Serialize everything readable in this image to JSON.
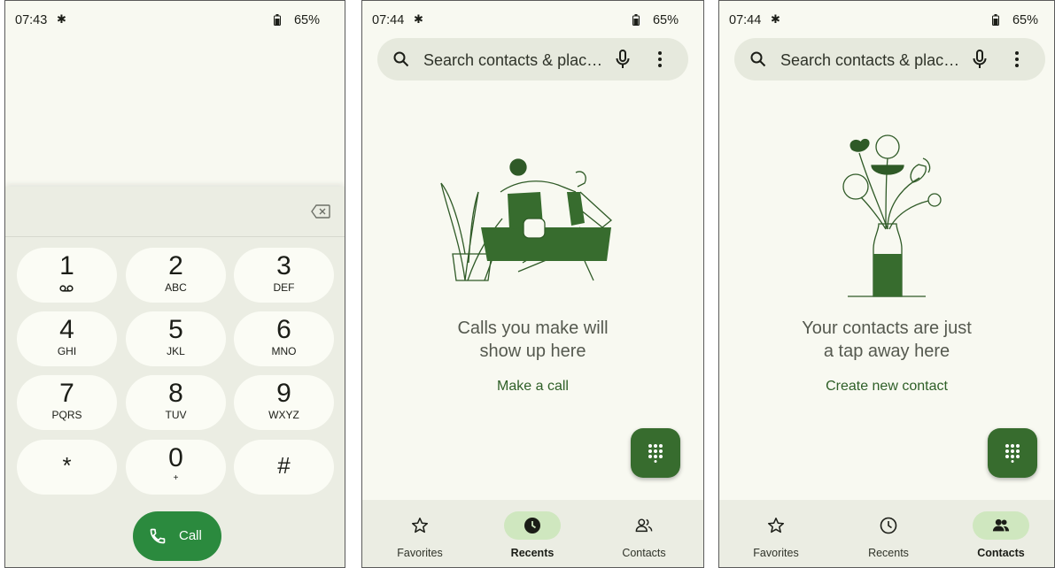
{
  "screens": [
    {
      "status": {
        "time": "07:43",
        "battery": "65%"
      },
      "dialpad": {
        "keys": [
          {
            "digit": "1",
            "letters": ""
          },
          {
            "digit": "2",
            "letters": "ABC"
          },
          {
            "digit": "3",
            "letters": "DEF"
          },
          {
            "digit": "4",
            "letters": "GHI"
          },
          {
            "digit": "5",
            "letters": "JKL"
          },
          {
            "digit": "6",
            "letters": "MNO"
          },
          {
            "digit": "7",
            "letters": "PQRS"
          },
          {
            "digit": "8",
            "letters": "TUV"
          },
          {
            "digit": "9",
            "letters": "WXYZ"
          },
          {
            "digit": "*",
            "letters": ""
          },
          {
            "digit": "0",
            "letters": "+"
          },
          {
            "digit": "#",
            "letters": ""
          }
        ],
        "call_label": "Call"
      }
    },
    {
      "status": {
        "time": "07:44",
        "battery": "65%"
      },
      "search": {
        "placeholder": "Search contacts & plac…"
      },
      "empty": {
        "title_line1": "Calls you make will",
        "title_line2": "show up here",
        "action": "Make a call"
      },
      "nav": {
        "favorites": "Favorites",
        "recents": "Recents",
        "contacts": "Contacts",
        "active": "recents"
      }
    },
    {
      "status": {
        "time": "07:44",
        "battery": "65%"
      },
      "search": {
        "placeholder": "Search contacts & plac…"
      },
      "empty": {
        "title_line1": "Your contacts are just",
        "title_line2": "a tap away here",
        "action": "Create new contact"
      },
      "nav": {
        "favorites": "Favorites",
        "recents": "Recents",
        "contacts": "Contacts",
        "active": "contacts"
      }
    }
  ],
  "colors": {
    "accent": "#376c2e",
    "call_button": "#2b8a3e",
    "nav_active_pill": "#cfe7bf",
    "background": "#f8f9f1"
  },
  "icons": [
    "settings-gear-icon",
    "battery-icon",
    "backspace-icon",
    "voicemail-icon",
    "phone-icon",
    "search-icon",
    "mic-icon",
    "more-vert-icon",
    "dialpad-icon",
    "star-icon",
    "clock-icon",
    "people-icon"
  ]
}
